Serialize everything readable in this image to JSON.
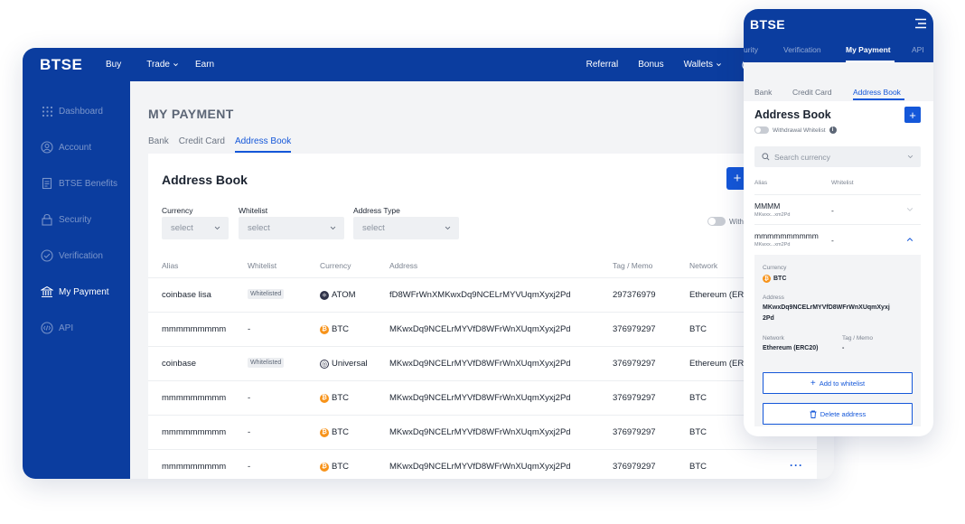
{
  "desktop": {
    "topbar": {
      "logo": "BTSE",
      "nav": [
        "Buy",
        "Trade",
        "Earn"
      ],
      "right": [
        "Referral",
        "Bonus",
        "Wallets"
      ]
    },
    "sidebar": {
      "items": [
        {
          "label": "Dashboard",
          "icon": "grid-icon"
        },
        {
          "label": "Account",
          "icon": "user-icon"
        },
        {
          "label": "BTSE Benefits",
          "icon": "benefits-icon"
        },
        {
          "label": "Security",
          "icon": "lock-icon"
        },
        {
          "label": "Verification",
          "icon": "check-circle-icon"
        },
        {
          "label": "My Payment",
          "icon": "bank-icon"
        },
        {
          "label": "API",
          "icon": "code-icon"
        }
      ]
    },
    "page_title": "MY PAYMENT",
    "tabs": [
      "Bank",
      "Credit Card",
      "Address Book"
    ],
    "card": {
      "title": "Address Book",
      "add_label": "+",
      "filters": {
        "currency_label": "Currency",
        "whitelist_label": "Whitelist",
        "address_type_label": "Address Type",
        "placeholder": "select"
      },
      "toggle_label": "With",
      "columns": [
        "Alias",
        "Whitelist",
        "Currency",
        "Address",
        "Tag / Memo",
        "Network"
      ],
      "rows": [
        {
          "alias": "coinbase lisa",
          "whitelist": "Whitelisted",
          "currency": "ATOM",
          "coin": "atom",
          "address": "fD8WFrWnXMKwxDq9NCELrMYVUqmXyxj2Pd",
          "tag": "297376979",
          "network": "Ethereum (ER"
        },
        {
          "alias": "mmmmmmmmm",
          "whitelist": "-",
          "currency": "BTC",
          "coin": "btc",
          "address": "MKwxDq9NCELrMYVfD8WFrWnXUqmXyxj2Pd",
          "tag": "376979297",
          "network": "BTC"
        },
        {
          "alias": "coinbase",
          "whitelist": "Whitelisted",
          "currency": "Universal",
          "coin": "universal",
          "address": "MKwxDq9NCELrMYVfD8WFrWnXUqmXyxj2Pd",
          "tag": "376979297",
          "network": "Ethereum (ER"
        },
        {
          "alias": "mmmmmmmmm",
          "whitelist": "-",
          "currency": "BTC",
          "coin": "btc",
          "address": "MKwxDq9NCELrMYVfD8WFrWnXUqmXyxj2Pd",
          "tag": "376979297",
          "network": "BTC"
        },
        {
          "alias": "mmmmmmmmm",
          "whitelist": "-",
          "currency": "BTC",
          "coin": "btc",
          "address": "MKwxDq9NCELrMYVfD8WFrWnXUqmXyxj2Pd",
          "tag": "376979297",
          "network": "BTC"
        },
        {
          "alias": "mmmmmmmmm",
          "whitelist": "-",
          "currency": "BTC",
          "coin": "btc",
          "address": "MKwxDq9NCELrMYVfD8WFrWnXUqmXyxj2Pd",
          "tag": "376979297",
          "network": "BTC"
        }
      ],
      "more_label": "···"
    }
  },
  "mobile": {
    "logo": "BTSE",
    "tabs": [
      "urity",
      "Verification",
      "My Payment",
      "API"
    ],
    "subtabs": [
      "Bank",
      "Credit Card",
      "Address Book"
    ],
    "title": "Address Book",
    "add_label": "+",
    "whitelist_toggle": "Withdrawal Whitelist",
    "search_placeholder": "Search currency",
    "columns": [
      "Alias",
      "Whitelist"
    ],
    "rows": [
      {
        "alias": "MMMM",
        "address": "MKwxx...xm2Pd",
        "whitelist": "-"
      },
      {
        "alias": "mmmmmmmmmm",
        "address": "MKwxx...xm2Pd",
        "whitelist": "-"
      }
    ],
    "detail": {
      "currency_label": "Currency",
      "currency_value": "BTC",
      "address_label": "Address",
      "address_line1": "MKwxDq9NCELrMYVfD8WFrWnXUqmXyxj",
      "address_line2": "2Pd",
      "network_label": "Network",
      "network_value": "Ethereum (ERC20)",
      "tag_label": "Tag / Memo",
      "tag_value": "-",
      "add_whitelist": "Add to whitelist",
      "delete_address": "Delete address"
    }
  },
  "colors": {
    "brand_blue": "#0b3d9f",
    "accent_blue": "#1457d9",
    "btc_orange": "#f7931a",
    "page_bg": "#f3f4f6"
  }
}
